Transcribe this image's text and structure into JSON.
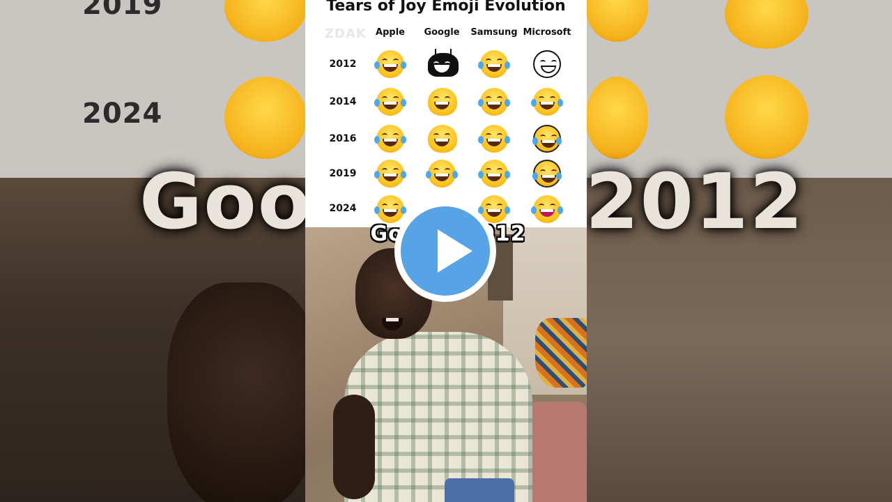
{
  "video": {
    "title": "Tears of Joy Emoji Evolution",
    "watermark": "ZDAK",
    "caption": "Google 2012"
  },
  "table": {
    "columns": [
      "Apple",
      "Google",
      "Samsung",
      "Microsoft"
    ],
    "rows": [
      {
        "year": "2012"
      },
      {
        "year": "2014"
      },
      {
        "year": "2016"
      },
      {
        "year": "2019"
      },
      {
        "year": "2024"
      }
    ]
  },
  "background": {
    "years": [
      "2019",
      "2024"
    ],
    "big_text_left": "Goo",
    "big_text_right": "2012"
  },
  "colors": {
    "play_button": "#56a3e6",
    "emoji_yellow": "#fcc21b",
    "tear_blue": "#4aa8f0"
  },
  "icons": {
    "play": "play-icon",
    "emoji": "face-with-tears-of-joy-icon"
  }
}
